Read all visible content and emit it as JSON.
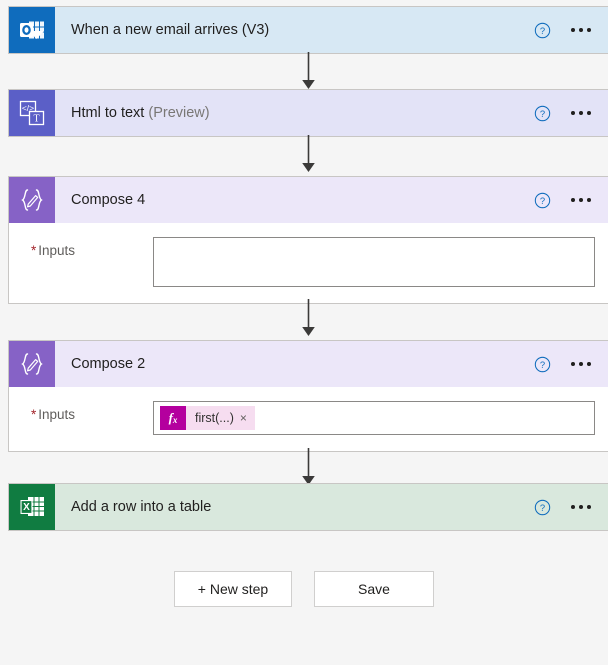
{
  "flow": {
    "steps": [
      {
        "id": "trigger-email",
        "title": "When a new email arrives (V3)",
        "suffix": "",
        "icon": "outlook-icon",
        "theme": "outlook",
        "expanded": false,
        "help_label": "?",
        "menu_label": "..."
      },
      {
        "id": "html-to-text",
        "title": "Html to text ",
        "suffix": "(Preview)",
        "icon": "html-to-text-icon",
        "theme": "html",
        "expanded": false,
        "help_label": "?",
        "menu_label": "..."
      },
      {
        "id": "compose-4",
        "title": "Compose 4",
        "suffix": "",
        "icon": "compose-icon",
        "theme": "compose",
        "expanded": true,
        "help_label": "?",
        "menu_label": "...",
        "field": {
          "required_marker": "*",
          "label": "Inputs",
          "value": "",
          "token": null
        }
      },
      {
        "id": "compose-2",
        "title": "Compose 2",
        "suffix": "",
        "icon": "compose-icon",
        "theme": "compose",
        "expanded": true,
        "help_label": "?",
        "menu_label": "...",
        "field": {
          "required_marker": "*",
          "label": "Inputs",
          "value": "",
          "token": {
            "badge": "fx",
            "text": "first(...)",
            "remove": "×"
          }
        }
      },
      {
        "id": "add-row-into-table",
        "title": "Add a row into a table",
        "suffix": "",
        "icon": "excel-icon",
        "theme": "excel",
        "expanded": false,
        "help_label": "?",
        "menu_label": "..."
      }
    ]
  },
  "footer": {
    "new_step_label": "+ New step",
    "save_label": "Save"
  },
  "colors": {
    "outlook_tile": "#0f6cbd",
    "outlook_header": "#d7e8f4",
    "html_tile": "#5b5fc7",
    "html_header": "#e3e3f7",
    "compose_tile": "#8662c6",
    "compose_header": "#ece7f9",
    "excel_tile": "#107c41",
    "excel_header": "#d9e8dd",
    "token_badge": "#b4009e",
    "token_background": "#f6ddf0",
    "required_asterisk": "#a4262c",
    "help_icon": "#0078d4",
    "connector": "#3b3a39",
    "canvas_background": "#f5f5f5"
  }
}
